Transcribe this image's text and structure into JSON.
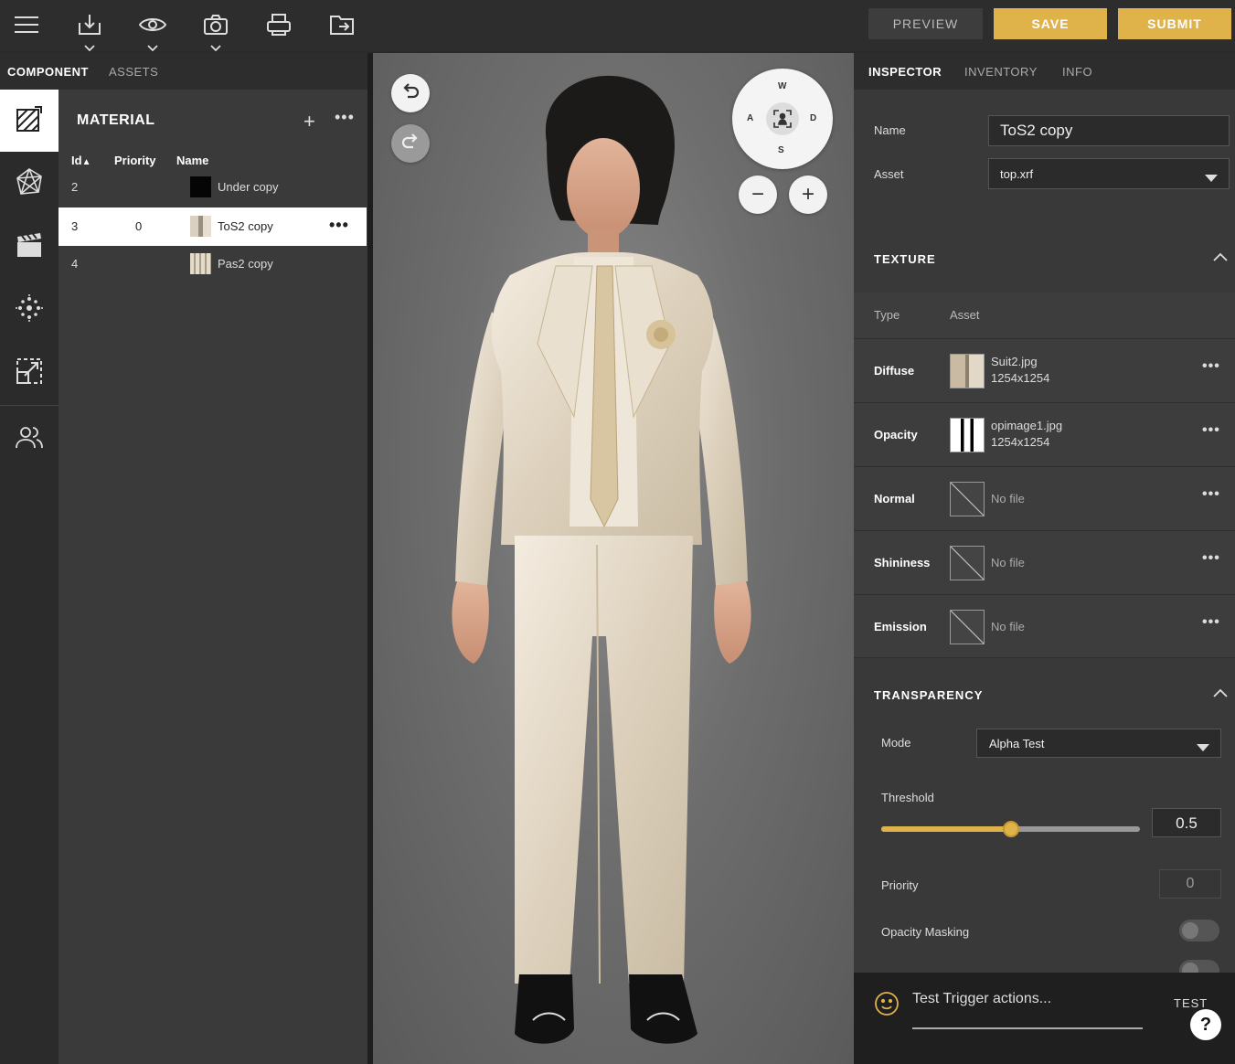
{
  "toolbar": {
    "preview_label": "PREVIEW",
    "save_label": "SAVE",
    "submit_label": "SUBMIT",
    "icons": [
      "menu-icon",
      "download-icon",
      "eye-icon",
      "camera-icon",
      "print-icon",
      "export-icon"
    ]
  },
  "left_tabs": {
    "component": "COMPONENT",
    "assets": "ASSETS"
  },
  "material": {
    "title": "MATERIAL",
    "columns": {
      "id": "Id",
      "priority": "Priority",
      "name": "Name"
    },
    "rows": [
      {
        "id": "2",
        "priority": "",
        "name": "Under copy",
        "selected": false
      },
      {
        "id": "3",
        "priority": "0",
        "name": "ToS2 copy",
        "selected": true
      },
      {
        "id": "4",
        "priority": "",
        "name": "Pas2 copy",
        "selected": false
      }
    ]
  },
  "nav_pad": {
    "w": "W",
    "a": "A",
    "s": "S",
    "d": "D"
  },
  "inspector": {
    "tabs": {
      "inspector": "INSPECTOR",
      "inventory": "INVENTORY",
      "info": "INFO"
    },
    "name_label": "Name",
    "name_value": "ToS2 copy",
    "asset_label": "Asset",
    "asset_value": "top.xrf",
    "texture": {
      "title": "TEXTURE",
      "type_header": "Type",
      "asset_header": "Asset",
      "rows": [
        {
          "label": "Diffuse",
          "file": "Suit2.jpg",
          "size": "1254x1254"
        },
        {
          "label": "Opacity",
          "file": "opimage1.jpg",
          "size": "1254x1254"
        },
        {
          "label": "Normal",
          "file": "No file",
          "size": ""
        },
        {
          "label": "Shininess",
          "file": "No file",
          "size": ""
        },
        {
          "label": "Emission",
          "file": "No file",
          "size": ""
        }
      ]
    },
    "transparency": {
      "title": "TRANSPARENCY",
      "mode_label": "Mode",
      "mode_value": "Alpha Test",
      "threshold_label": "Threshold",
      "threshold_value": "0.5",
      "threshold_fraction": 0.5,
      "priority_label": "Priority",
      "priority_value": "0",
      "opacity_masking_label": "Opacity Masking",
      "opacity_masking_on": false
    },
    "test": {
      "placeholder": "Test Trigger actions...",
      "button": "TEST",
      "help": "?"
    }
  },
  "colors": {
    "accent": "#e0b24a",
    "panel": "#393939",
    "dark": "#2d2d2d"
  }
}
